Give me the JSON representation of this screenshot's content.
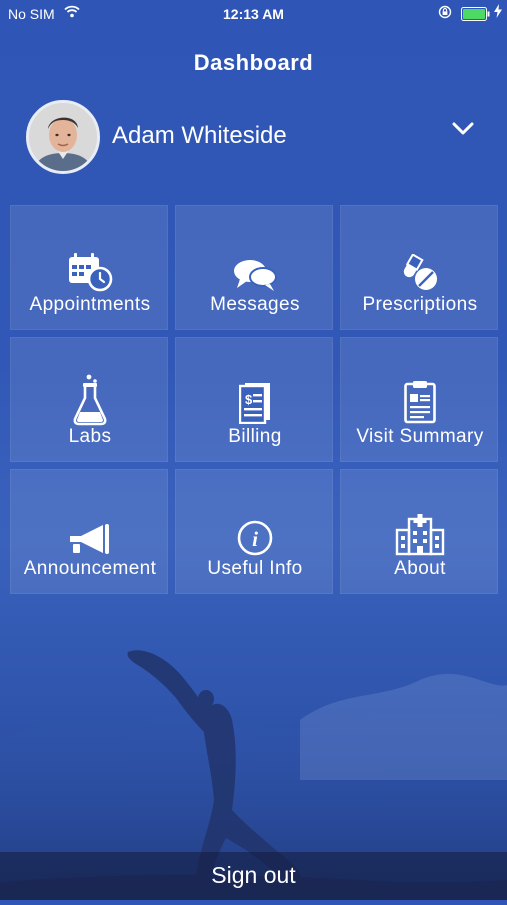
{
  "status_bar": {
    "carrier": "No SIM",
    "time": "12:13 AM"
  },
  "header": {
    "title": "Dashboard"
  },
  "profile": {
    "name": "Adam Whiteside"
  },
  "tiles": [
    {
      "label": "Appointments",
      "icon": "calendar-clock-icon"
    },
    {
      "label": "Messages",
      "icon": "chat-bubbles-icon"
    },
    {
      "label": "Prescriptions",
      "icon": "pills-icon"
    },
    {
      "label": "Labs",
      "icon": "flask-icon"
    },
    {
      "label": "Billing",
      "icon": "invoice-icon"
    },
    {
      "label": "Visit Summary",
      "icon": "clipboard-icon"
    },
    {
      "label": "Announcement",
      "icon": "megaphone-icon"
    },
    {
      "label": "Useful Info",
      "icon": "info-icon"
    },
    {
      "label": "About",
      "icon": "hospital-icon"
    }
  ],
  "footer": {
    "signout_label": "Sign out"
  },
  "colors": {
    "background": "#3158b6",
    "tile": "rgba(255,255,255,0.10)",
    "text": "#ffffff",
    "battery": "#4cd964"
  }
}
